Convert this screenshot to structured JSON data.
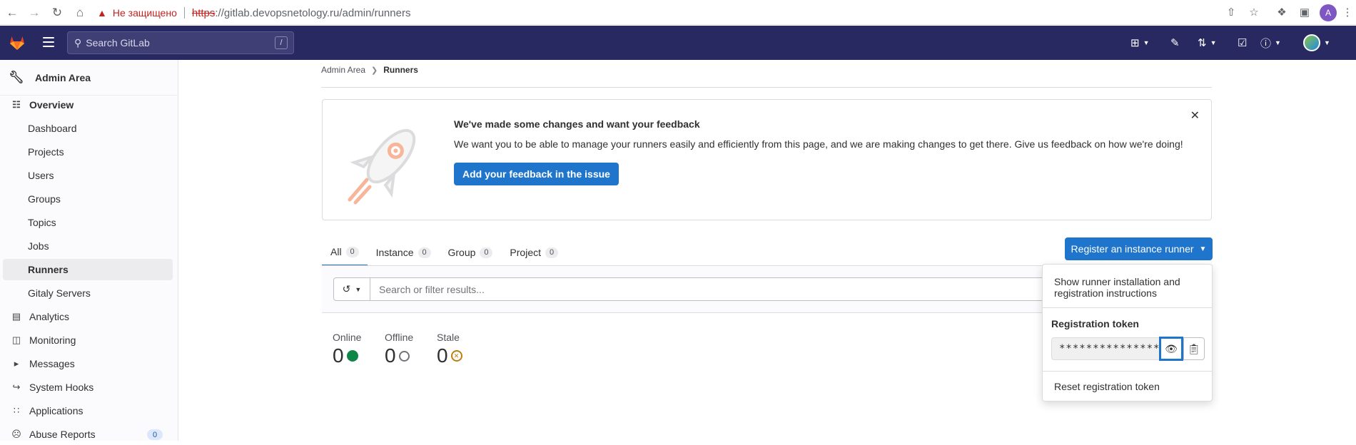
{
  "browser": {
    "insecure_label": "Не защищено",
    "url_protocol": "https",
    "url_rest": "://gitlab.devopsnetology.ru/admin/runners",
    "profile_initial": "A"
  },
  "topbar": {
    "search_placeholder": "Search GitLab",
    "search_shortcut": "/"
  },
  "sidebar": {
    "header": "Admin Area",
    "items": [
      {
        "label": "Overview"
      },
      {
        "label": "Dashboard"
      },
      {
        "label": "Projects"
      },
      {
        "label": "Users"
      },
      {
        "label": "Groups"
      },
      {
        "label": "Topics"
      },
      {
        "label": "Jobs"
      },
      {
        "label": "Runners"
      },
      {
        "label": "Gitaly Servers"
      },
      {
        "label": "Analytics"
      },
      {
        "label": "Monitoring"
      },
      {
        "label": "Messages"
      },
      {
        "label": "System Hooks"
      },
      {
        "label": "Applications"
      },
      {
        "label": "Abuse Reports",
        "badge": "0"
      }
    ]
  },
  "breadcrumb": {
    "parent": "Admin Area",
    "current": "Runners"
  },
  "banner": {
    "title": "We've made some changes and want your feedback",
    "text": "We want you to be able to manage your runners easily and efficiently from this page, and we are making changes to get there. Give us feedback on how we're doing!",
    "button": "Add your feedback in the issue"
  },
  "tabs": [
    {
      "label": "All",
      "count": "0"
    },
    {
      "label": "Instance",
      "count": "0"
    },
    {
      "label": "Group",
      "count": "0"
    },
    {
      "label": "Project",
      "count": "0"
    }
  ],
  "filter": {
    "placeholder": "Search or filter results..."
  },
  "stats": {
    "online": {
      "label": "Online",
      "value": "0"
    },
    "offline": {
      "label": "Offline",
      "value": "0"
    },
    "stale": {
      "label": "Stale",
      "value": "0"
    }
  },
  "register": {
    "button": "Register an instance runner",
    "show_instructions": "Show runner installation and registration instructions",
    "token_label": "Registration token",
    "token_value": "***************",
    "reset": "Reset registration token"
  },
  "colors": {
    "topbar": "#292961",
    "primary": "#1f75cb",
    "online": "#108548",
    "stale": "#c17d10"
  }
}
